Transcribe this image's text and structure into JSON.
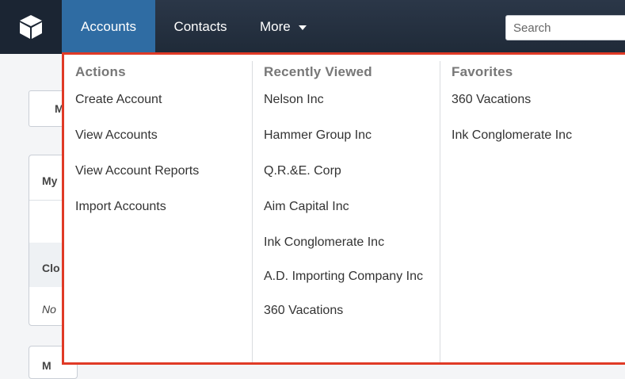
{
  "navbar": {
    "logo_icon": "cube-logo-icon",
    "tabs": [
      {
        "label": "Accounts"
      },
      {
        "label": "Contacts"
      },
      {
        "label": "More"
      }
    ],
    "search": {
      "placeholder": "Search"
    }
  },
  "background_fragments": {
    "tab_fragment": "M",
    "panel_title_fragment": "My",
    "section_fragment": "Clo",
    "italic_fragment": "No",
    "bottom_fragment": "M"
  },
  "dropdown": {
    "actions": {
      "title": "Actions",
      "items": [
        "Create Account",
        "View Accounts",
        "View Account Reports",
        "Import Accounts"
      ]
    },
    "recently_viewed": {
      "title": "Recently Viewed",
      "items": [
        "Nelson Inc",
        "Hammer Group Inc",
        "Q.R.&E. Corp",
        "Aim Capital Inc",
        "Ink Conglomerate Inc",
        "A.D. Importing Company Inc",
        "360 Vacations"
      ]
    },
    "favorites": {
      "title": "Favorites",
      "items": [
        "360 Vacations",
        "Ink Conglomerate Inc"
      ]
    }
  },
  "colors": {
    "navbar": "#25303f",
    "active_tab": "#2f6ca3",
    "highlight_border": "#e03a26"
  }
}
